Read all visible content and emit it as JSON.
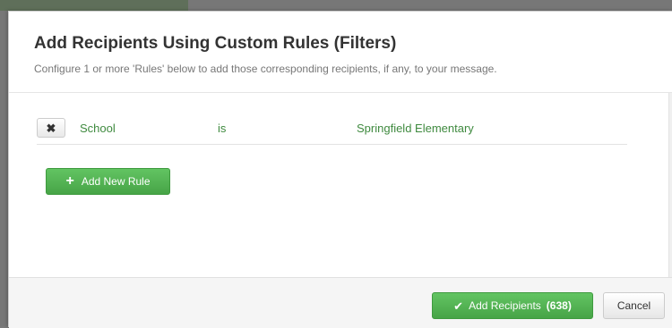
{
  "modal": {
    "title": "Add Recipients Using Custom Rules (Filters)",
    "subtitle": "Configure 1 or more 'Rules' below to add those corresponding recipients, if any, to your message."
  },
  "rules": [
    {
      "remove_icon": "✖",
      "field": "School",
      "operator": "is",
      "value": "Springfield Elementary"
    }
  ],
  "add_rule": {
    "icon": "+",
    "label": "Add New Rule"
  },
  "footer": {
    "add_recipients_icon": "✔",
    "add_recipients_label": "Add Recipients",
    "recipient_count_text": "(638)",
    "cancel_label": "Cancel"
  },
  "colors": {
    "accent_green": "#47a447",
    "rule_text_green": "#3f8a3f"
  }
}
